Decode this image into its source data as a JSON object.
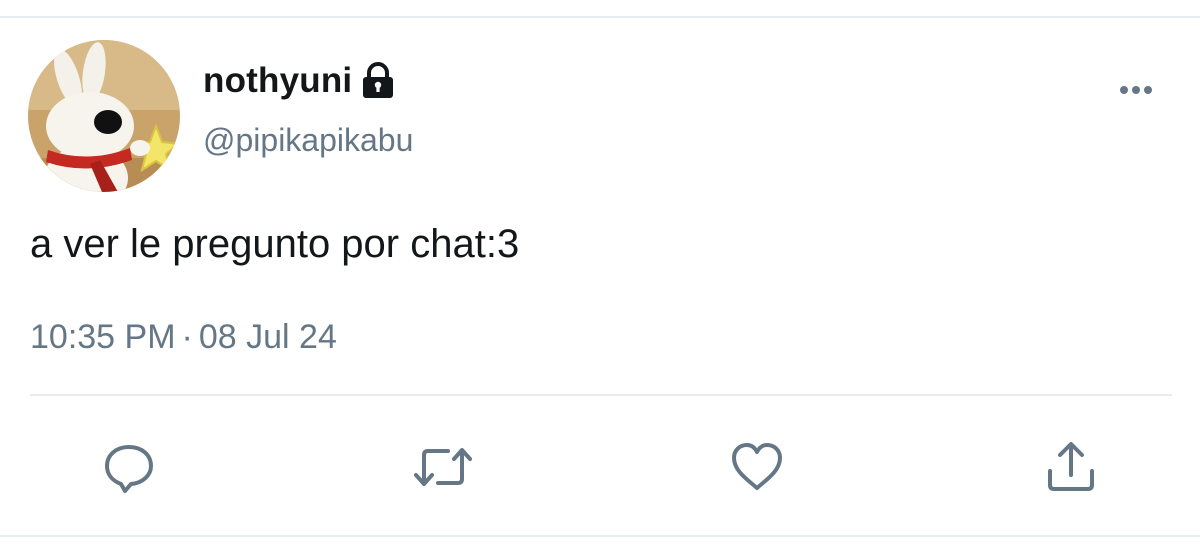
{
  "tweet": {
    "display_name": "nothyuni",
    "handle": "@pipikapikabu",
    "text": "a ver le pregunto por chat:3",
    "time": "10:35 PM",
    "separator": "·",
    "date": "08 Jul 24",
    "protected": true
  },
  "icons": {
    "lock": "lock-icon",
    "more": "more-horizontal-icon",
    "reply": "reply-bubble-icon",
    "retweet": "retweet-icon",
    "like": "heart-icon",
    "share": "share-upload-icon"
  },
  "colors": {
    "text_primary": "#14171a",
    "text_secondary": "#657786",
    "divider": "#e6ecf0",
    "action_icon": "#657786"
  }
}
